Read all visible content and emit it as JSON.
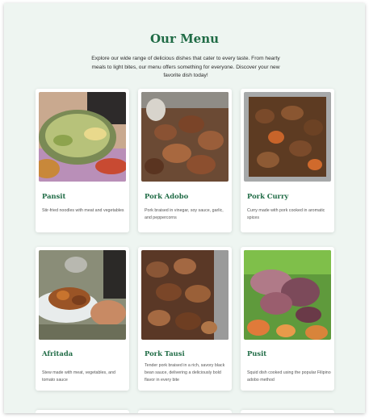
{
  "page": {
    "title": "Our Menu",
    "intro": "Explore our wide range of delicious dishes that cater to every taste. From hearty meals to light bites, our menu offers something for everyone. Discover your new favorite dish today!"
  },
  "colors": {
    "accent": "#1f6b45",
    "background": "#eef5f1",
    "card": "#ffffff"
  },
  "menu": {
    "items": [
      {
        "name": "Pansit",
        "description": "Stir-fried noodles with meat and vegetables",
        "image": "pansit-photo"
      },
      {
        "name": "Pork Adobo",
        "description": "Pork braised in vinegar, soy sauce, garlic, and peppercorns",
        "image": "pork-adobo-photo"
      },
      {
        "name": "Pork Curry",
        "description": "Curry made with pork cooked in aromatic spices",
        "image": "pork-curry-photo"
      },
      {
        "name": "Afritada",
        "description": "Stew made with meat, vegetables, and tomato sauce",
        "image": "afritada-photo"
      },
      {
        "name": "Pork Tausi",
        "description": "Tender pork braised in a rich, savory black bean sauce, delivering a deliciously bold flavor in every bite",
        "image": "pork-tausi-photo"
      },
      {
        "name": "Pusit",
        "description": "Squid dish cooked using the popular Filipino adobo method",
        "image": "pusit-photo"
      }
    ]
  }
}
